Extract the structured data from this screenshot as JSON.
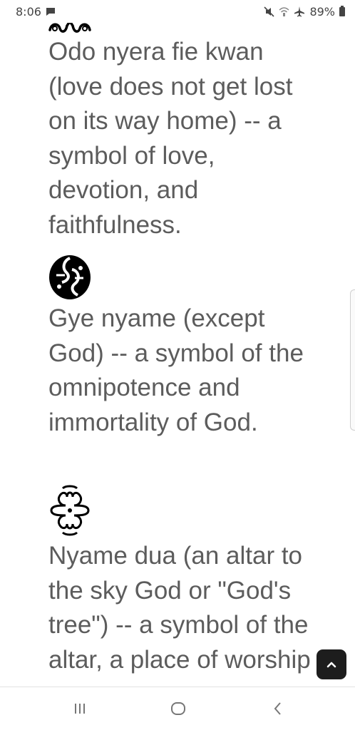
{
  "status_bar": {
    "time": "8:06",
    "battery": "89%",
    "icons": [
      "message-icon",
      "mute-icon",
      "wifi-calling-icon",
      "airplane-icon",
      "battery-icon"
    ]
  },
  "entries": [
    {
      "symbol": "odo-nyera-fie-kwan-icon",
      "text": "Odo nyera fie kwan (love does not get lost on its way home) -- a symbol of love, devotion, and faithfulness."
    },
    {
      "symbol": "gye-nyame-icon",
      "text": "Gye nyame (except God) -- a symbol of the omnipotence and immortality of God."
    },
    {
      "symbol": "nyame-dua-icon",
      "text": "Nyame dua (an altar to the sky God or \"God's tree\") -- a symbol of the altar, a place of worship"
    }
  ],
  "scroll_top_button": {
    "icon": "chevron-up-icon"
  },
  "nav_bar": {
    "icons": [
      "recent-apps-icon",
      "home-icon",
      "back-icon"
    ]
  },
  "colors": {
    "text": "#5c5c5c",
    "button_bg": "#1d1d1d",
    "symbol": "#000000"
  }
}
